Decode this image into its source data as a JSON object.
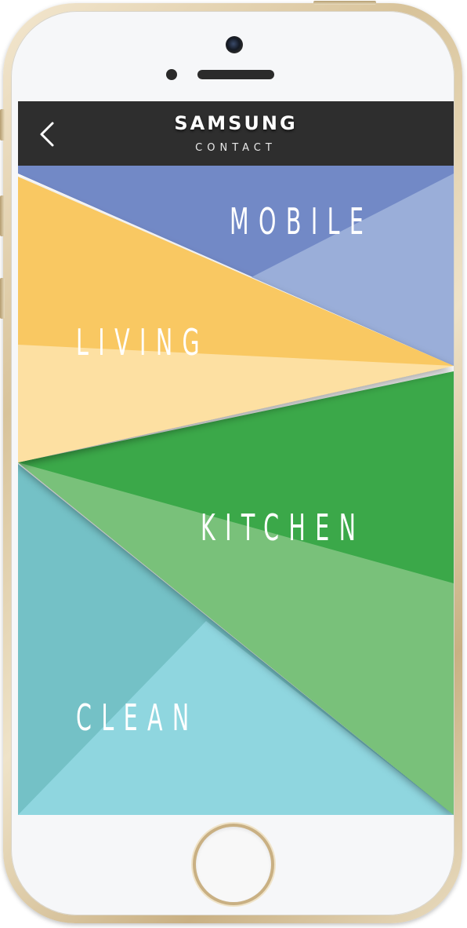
{
  "header": {
    "brand": "SAMSUNG",
    "subtitle": "CONTACT"
  },
  "categories": [
    {
      "label": "MOBILE",
      "colors": [
        "#7289c6",
        "#9aaed9"
      ]
    },
    {
      "label": "LIVING",
      "colors": [
        "#f9c862",
        "#fde0a2"
      ]
    },
    {
      "label": "KITCHEN",
      "colors": [
        "#3aa84a",
        "#79c17a"
      ]
    },
    {
      "label": "CLEAN",
      "colors": [
        "#74c1c6",
        "#8fd6df"
      ]
    }
  ]
}
